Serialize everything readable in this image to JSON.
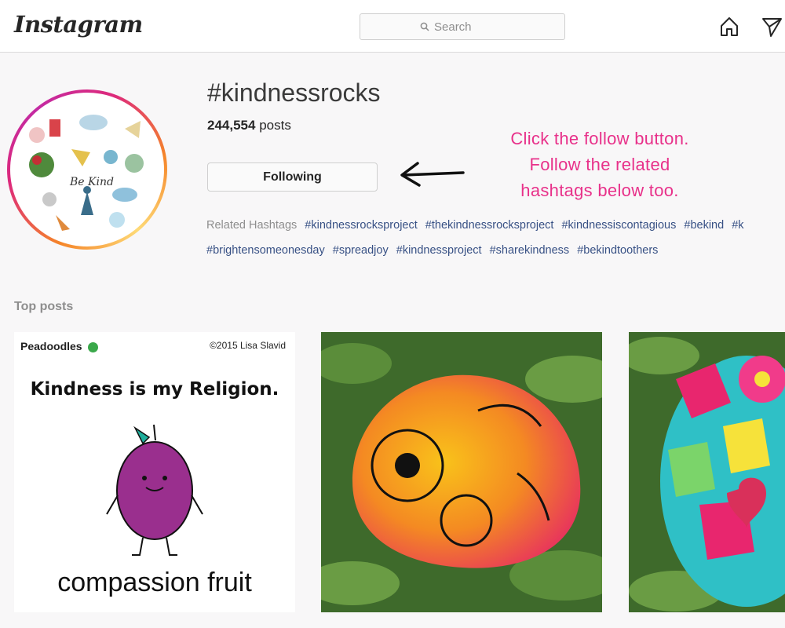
{
  "header": {
    "logo": "Instagram",
    "search_placeholder": "Search",
    "icons": [
      "home-icon",
      "direct-send-icon"
    ]
  },
  "hashtag": {
    "title": "#kindnessrocks",
    "post_count": "244,554",
    "post_count_suffix": "posts",
    "follow_label": "Following",
    "avatar_text": "Be Kind"
  },
  "annotation": {
    "lines": [
      "Click the follow button.",
      "Follow the related",
      "hashtags below too."
    ],
    "color": "#e8318a"
  },
  "related": {
    "label": "Related Hashtags",
    "row1": [
      "#kindnessrocksproject",
      "#thekindnessrocksproject",
      "#kindnessiscontagious",
      "#bekind",
      "#k"
    ],
    "row2": [
      "#brightensomeonesday",
      "#spreadjoy",
      "#kindnessproject",
      "#sharekindness",
      "#bekindtoothers"
    ]
  },
  "top_posts": {
    "label": "Top posts",
    "post1": {
      "brand": "Peadoodles",
      "copyright": "©2015 Lisa Slavid",
      "heading": "Kindness is my Religion.",
      "caption": "compassion fruit"
    }
  },
  "colors": {
    "link": "#385185",
    "muted": "#8e8e8e",
    "accent": "#e8318a"
  }
}
